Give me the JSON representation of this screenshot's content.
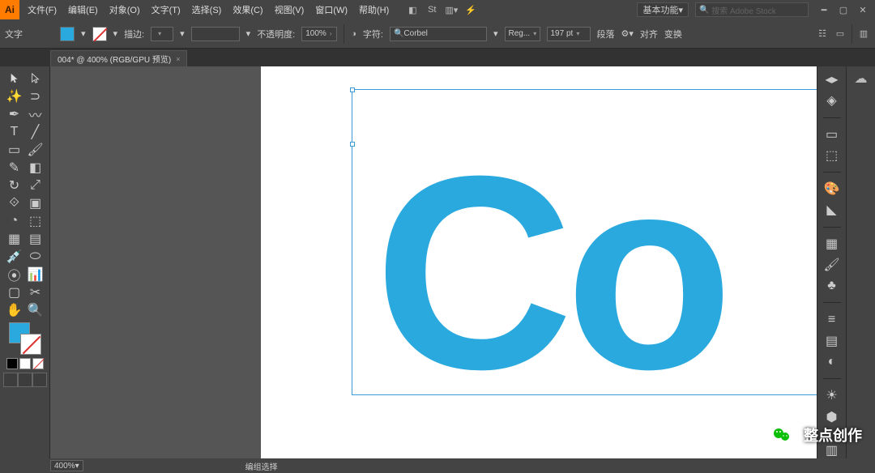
{
  "app_logo": "Ai",
  "menus": {
    "file": "文件(F)",
    "edit": "编辑(E)",
    "object": "对象(O)",
    "type": "文字(T)",
    "select": "选择(S)",
    "effect": "效果(C)",
    "view": "视图(V)",
    "window": "窗口(W)",
    "help": "帮助(H)"
  },
  "workspace_selector": "基本功能",
  "stock_search": {
    "icon": "🔍",
    "placeholder": "搜索 Adobe Stock"
  },
  "control_bar": {
    "tool_label": "文字",
    "stroke_label": "描边:",
    "opacity_label": "不透明度:",
    "opacity_value": "100%",
    "char_label": "字符:",
    "font_name": "Corbel",
    "font_style": "Reg...",
    "font_size": "197 pt",
    "para_label": "段落",
    "align_label": "对齐",
    "transform_label": "变换"
  },
  "document_tab": {
    "title": "004* @ 400% (RGB/GPU 预览)",
    "close": "×"
  },
  "canvas": {
    "text_content": "Co"
  },
  "status": {
    "zoom": "400%",
    "text": "编组选择"
  },
  "watermark_text": "整点创作",
  "fill_color": "#2aa9df"
}
